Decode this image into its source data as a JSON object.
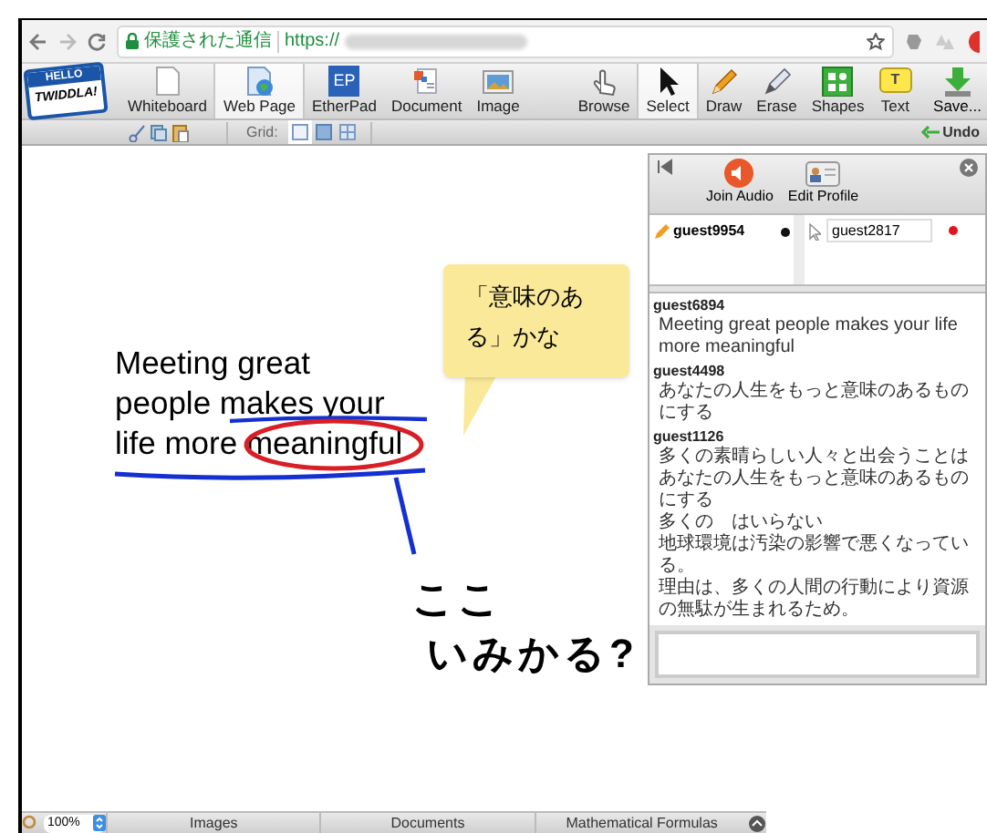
{
  "browser": {
    "security_label": "保護された通信",
    "url": "https://"
  },
  "logo": {
    "top": "HELLO",
    "bottom": "TWIDDLA!"
  },
  "content_tools": [
    {
      "label": "Whiteboard",
      "kind": "whiteboard",
      "selected": false
    },
    {
      "label": "Web Page",
      "kind": "webpage",
      "selected": true
    },
    {
      "label": "EtherPad",
      "kind": "etherpad",
      "selected": false,
      "icon_text": "EP"
    },
    {
      "label": "Document",
      "kind": "document",
      "selected": false
    },
    {
      "label": "Image",
      "kind": "image",
      "selected": false
    }
  ],
  "edit_tools": [
    {
      "label": "Browse",
      "kind": "browse",
      "selected": false
    },
    {
      "label": "Select",
      "kind": "select",
      "selected": true
    },
    {
      "label": "Draw",
      "kind": "draw",
      "selected": false
    },
    {
      "label": "Erase",
      "kind": "erase",
      "selected": false
    },
    {
      "label": "Shapes",
      "kind": "shapes",
      "selected": false
    },
    {
      "label": "Text",
      "kind": "text",
      "selected": false,
      "icon_text": "T"
    }
  ],
  "save": "Save...",
  "subbar": {
    "grid_label": "Grid:",
    "grid_options": [
      {
        "kind": "plain",
        "selected": true
      },
      {
        "kind": "filled",
        "selected": false
      },
      {
        "kind": "lines",
        "selected": false
      }
    ],
    "undo": "Undo"
  },
  "canvas": {
    "text_lines": [
      "Meeting great",
      "people makes your",
      "life more meaningful"
    ],
    "callout": "「意味のある」かな",
    "handwriting": [
      "ここ",
      "いみかる?"
    ]
  },
  "chat": {
    "join_audio": "Join Audio",
    "edit_profile": "Edit Profile",
    "local_users": [
      {
        "name": "guest9954",
        "color": "#111111"
      }
    ],
    "remote_users": [
      {
        "name": "guest2817",
        "color": "#e0141e"
      }
    ],
    "messages": [
      {
        "author": "guest6894",
        "lines": [
          "Meeting great people makes your life more meaningful"
        ]
      },
      {
        "author": "guest4498",
        "lines": [
          "あなたの人生をもっと意味のあるものにする"
        ]
      },
      {
        "author": "guest1126",
        "lines": [
          "多くの素晴らしい人々と出会うことはあなたの人生をもっと意味のあるものにする",
          "多くの　はいらない",
          "地球環境は汚染の影響で悪くなっている。",
          "理由は、多くの人間の行動により資源の無駄が生まれるため。"
        ]
      }
    ]
  },
  "bottom": {
    "zoom": "100%",
    "tabs": [
      "Images",
      "Documents",
      "Mathematical Formulas"
    ]
  }
}
